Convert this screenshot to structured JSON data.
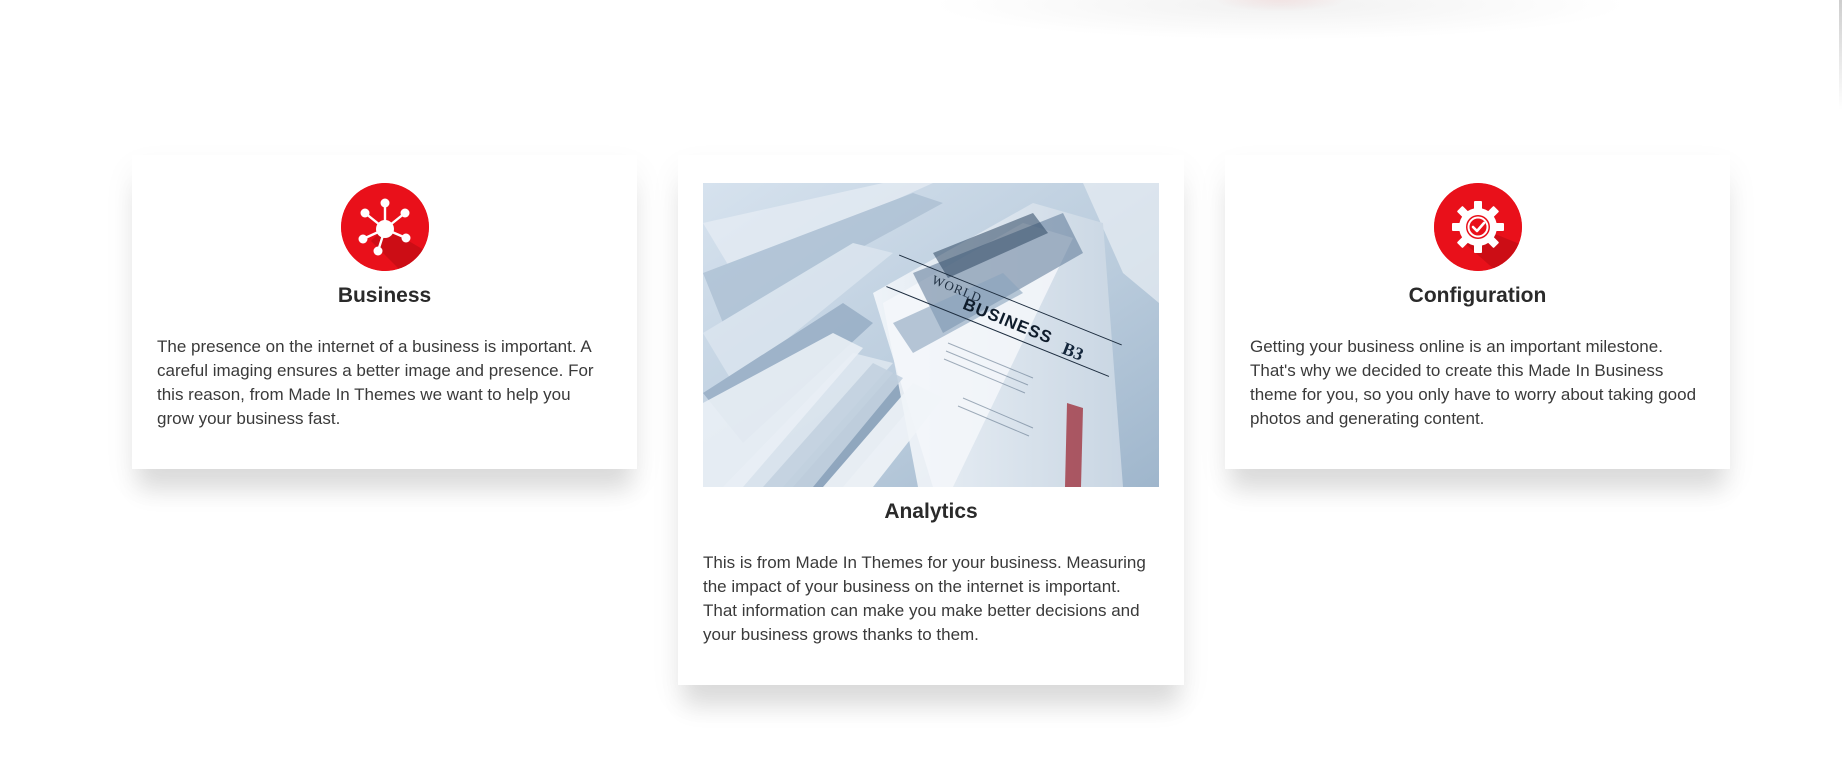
{
  "features": {
    "business": {
      "title": "Business",
      "description": "The presence on the internet of a business is important. A careful imaging ensures a better image and presence. For this reason, from Made In Themes we want to help you grow your business fast.",
      "icon": "network-icon"
    },
    "analytics": {
      "title": "Analytics",
      "description": "This is from Made In Themes for your business. Measuring the impact of your business on the internet is important. That information can make you make better decisions and your business grows thanks to them.",
      "image": "newspaper-photo",
      "image_text": {
        "world": "WORLD",
        "business": "BUSINESS",
        "page": "B3"
      }
    },
    "configuration": {
      "title": "Configuration",
      "description": "Getting your business online is an important milestone. That's why we decided to create this Made In Business theme for you, so you only have to worry about taking good photos and generating content.",
      "icon": "gear-check-icon"
    }
  },
  "colors": {
    "accent": "#e9101a",
    "accent_dark": "#b50b12",
    "title": "#2a2a2a",
    "text": "#3a3a3a",
    "background": "#ffffff"
  }
}
